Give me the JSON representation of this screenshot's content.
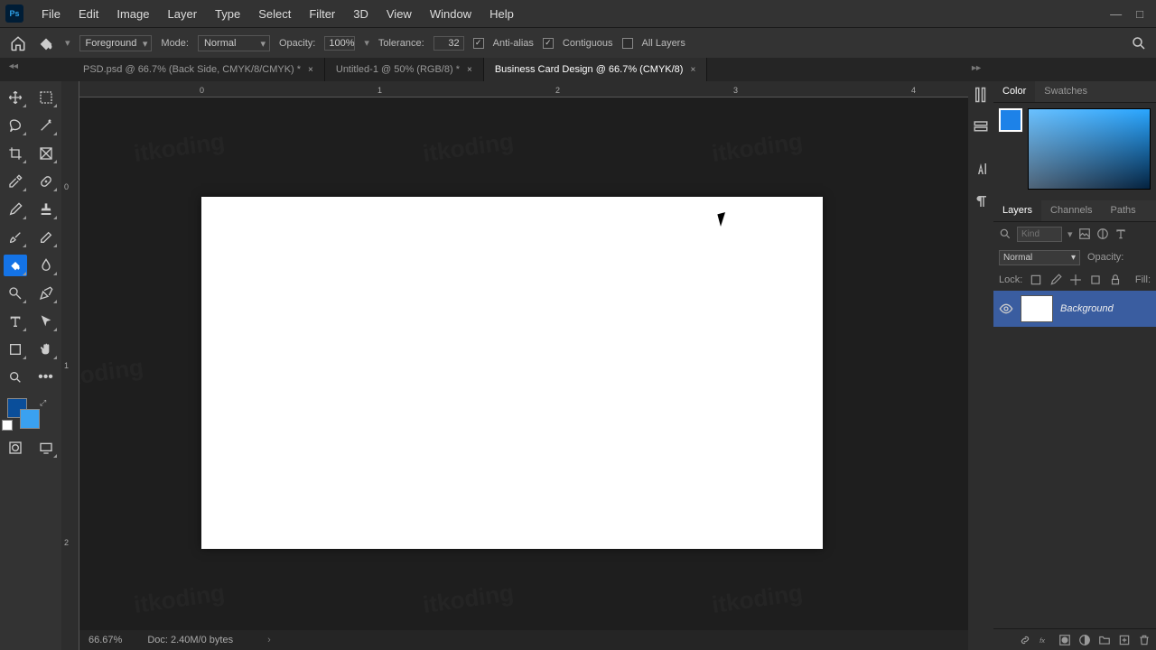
{
  "menu": {
    "items": [
      "File",
      "Edit",
      "Image",
      "Layer",
      "Type",
      "Select",
      "Filter",
      "3D",
      "View",
      "Window",
      "Help"
    ]
  },
  "options": {
    "fill_mode": "Foreground",
    "mode_label": "Mode:",
    "mode_value": "Normal",
    "opacity_label": "Opacity:",
    "opacity_value": "100%",
    "tolerance_label": "Tolerance:",
    "tolerance_value": "32",
    "antialias": "Anti-alias",
    "contiguous": "Contiguous",
    "all_layers": "All Layers"
  },
  "tabs": [
    {
      "label": "PSD.psd @ 66.7% (Back Side, CMYK/8/CMYK) *",
      "active": false,
      "close": "×"
    },
    {
      "label": "Untitled-1 @ 50% (RGB/8) *",
      "active": false,
      "close": "×"
    },
    {
      "label": "Business Card Design @ 66.7% (CMYK/8)",
      "active": true,
      "close": "×"
    }
  ],
  "ruler": {
    "h": [
      "0",
      "1",
      "2",
      "3",
      "4"
    ],
    "v": [
      "0",
      "1",
      "2"
    ]
  },
  "status": {
    "zoom": "66.67%",
    "doc": "Doc: 2.40M/0 bytes",
    "chev": "›"
  },
  "panels": {
    "color_tabs": [
      "Color",
      "Swatches"
    ],
    "layer_tabs": [
      "Layers",
      "Channels",
      "Paths"
    ],
    "kind_placeholder": "Kind",
    "blend_value": "Normal",
    "opacity_label": "Opacity:",
    "lock_label": "Lock:",
    "fill_label": "Fill:",
    "background_layer": "Background"
  },
  "watermark": "itkoding"
}
